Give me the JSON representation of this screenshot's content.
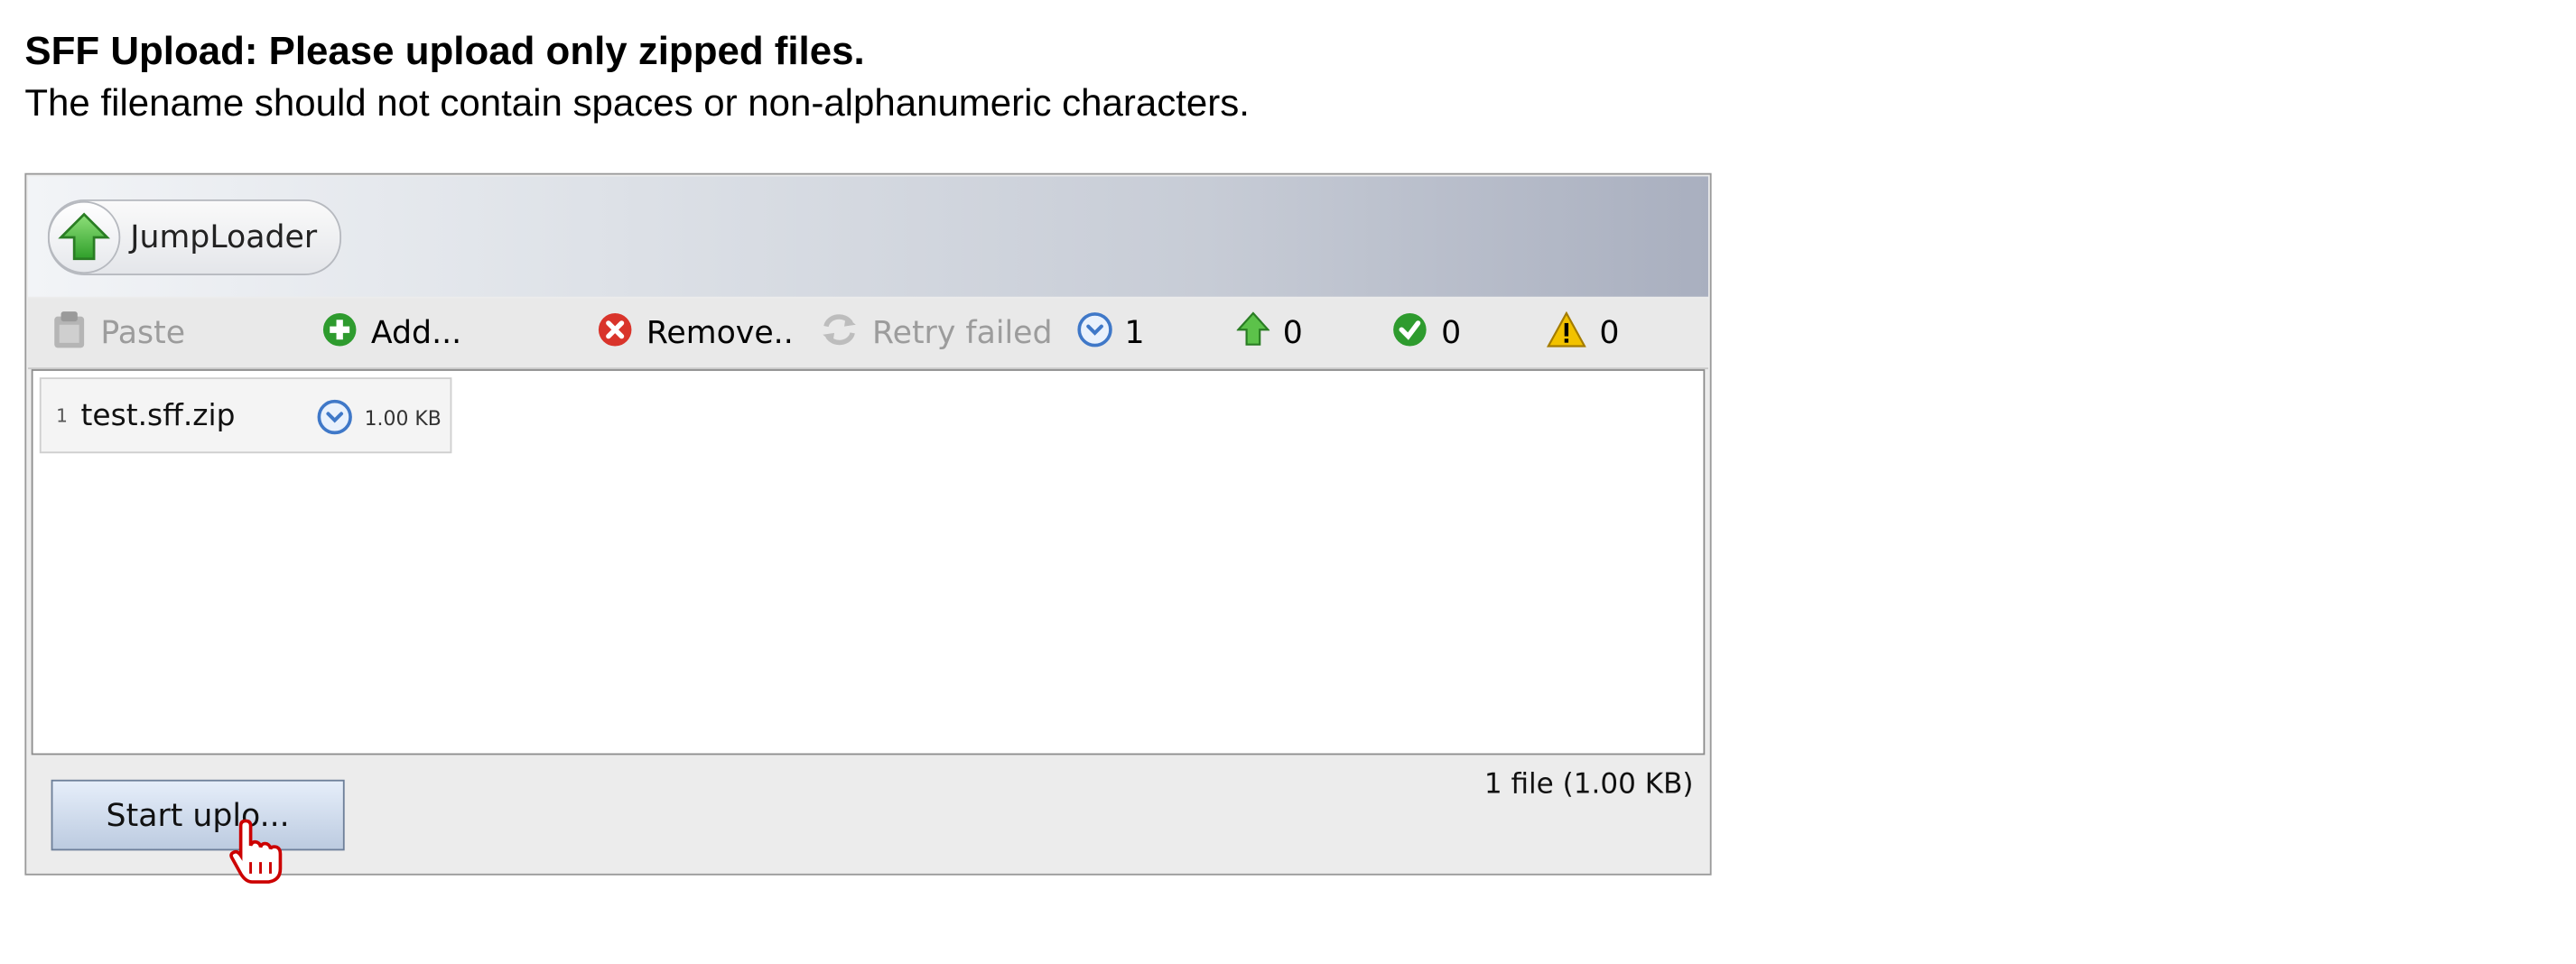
{
  "page": {
    "heading": "SFF Upload: Please upload only zipped files.",
    "subheading": "The filename should not contain spaces or non-alphanumeric characters."
  },
  "applet": {
    "brand": {
      "label": "JumpLoader",
      "icon": "green-up-arrow-icon"
    },
    "toolbar": {
      "paste_label": "Paste",
      "add_label": "Add...",
      "remove_label": "Remove..",
      "retry_label": "Retry failed",
      "counters": {
        "pending": "1",
        "uploading": "0",
        "done": "0",
        "failed": "0"
      }
    },
    "files": [
      {
        "index": "1",
        "name": "test.sff.zip",
        "size": "1.00 KB",
        "status_icon": "pending-clock-icon"
      }
    ],
    "start_button_label": "Start uplo...",
    "summary": "1 file (1.00 KB)"
  },
  "colors": {
    "header_gradient_end": "#a9afbf",
    "add_green": "#2e9b2e",
    "remove_red": "#d9342b",
    "pending_blue": "#3f78c8",
    "warning_yellow": "#f2c200"
  }
}
